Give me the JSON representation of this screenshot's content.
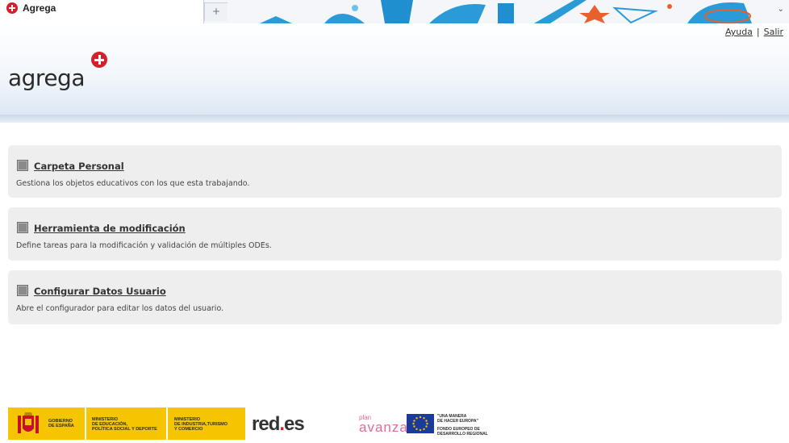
{
  "browser": {
    "tab_title": "Agrega",
    "new_tab_glyph": "+",
    "tab_list_glyph": "⌄"
  },
  "header": {
    "logo_text": "agrega",
    "links": {
      "help": "Ayuda",
      "separator": "|",
      "exit": "Salir"
    }
  },
  "panels": [
    {
      "title": "Carpeta Personal",
      "description": "Gestiona los objetos educativos con los que esta trabajando."
    },
    {
      "title": "Herramienta de modificación",
      "description": "Define tareas para la modificación y validación de múltiples ODEs."
    },
    {
      "title": "Configurar Datos Usuario",
      "description": "Abre el configurador para editar los datos del usuario."
    }
  ],
  "footer": {
    "gobierno": [
      "GOBIERNO",
      "DE ESPAÑA"
    ],
    "ministerio_educacion": [
      "MINISTERIO",
      "DE EDUCACIÓN,",
      "POLÍTICA SOCIAL Y DEPORTE"
    ],
    "ministerio_industria": [
      "MINISTERIO",
      "DE INDUSTRIA,TURISMO",
      "Y COMERCIO"
    ],
    "redes": {
      "part1": "red",
      "dot": ".",
      "part2": "es"
    },
    "plan": "plan",
    "avanza": "avanza",
    "eu_text": [
      "\"UNA MANERA",
      "DE HACER EUROPA\"",
      "",
      "FONDO EUROPEO DE",
      "DESARROLLO REGIONAL"
    ]
  },
  "colors": {
    "brand_red": "#d22128",
    "panel_bg": "#eeeeee",
    "gov_yellow": "#f4c500",
    "eu_blue": "#1a3b9a"
  }
}
